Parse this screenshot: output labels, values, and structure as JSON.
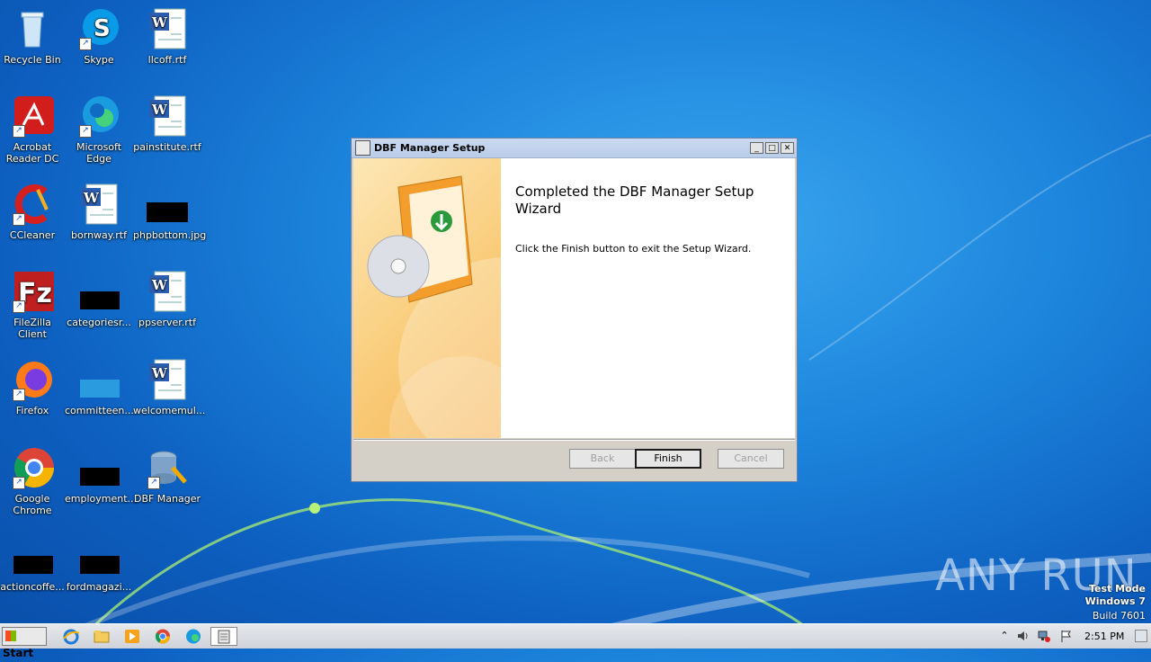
{
  "desktop": {
    "icons": [
      {
        "label": "Recycle Bin"
      },
      {
        "label": "Skype"
      },
      {
        "label": "llcoff.rtf"
      },
      {
        "label": "Acrobat Reader DC"
      },
      {
        "label": "Microsoft Edge"
      },
      {
        "label": "painstitute.rtf"
      },
      {
        "label": "CCleaner"
      },
      {
        "label": "bornway.rtf"
      },
      {
        "label": "phpbottom.jpg"
      },
      {
        "label": "FileZilla Client"
      },
      {
        "label": "categoriesr..."
      },
      {
        "label": "ppserver.rtf"
      },
      {
        "label": "Firefox"
      },
      {
        "label": "committeen..."
      },
      {
        "label": "welcomemul..."
      },
      {
        "label": "Google Chrome"
      },
      {
        "label": "employment..."
      },
      {
        "label": "DBF Manager"
      },
      {
        "label": "actioncoffe..."
      },
      {
        "label": "fordmagazi..."
      }
    ]
  },
  "dialog": {
    "title": "DBF Manager Setup",
    "heading": "Completed the DBF Manager Setup Wizard",
    "message": "Click the Finish button to exit the Setup Wizard.",
    "buttons": {
      "back": "Back",
      "finish": "Finish",
      "cancel": "Cancel"
    },
    "title_buttons": {
      "minimize": "_",
      "maximize": "□",
      "close": "✕"
    }
  },
  "taskbar": {
    "start_label": "Start",
    "clock": "2:51 PM"
  },
  "watermark": {
    "brand": "ANY RUN",
    "line1": "Test Mode",
    "line2": "Windows 7",
    "line3": "Build 7601"
  }
}
